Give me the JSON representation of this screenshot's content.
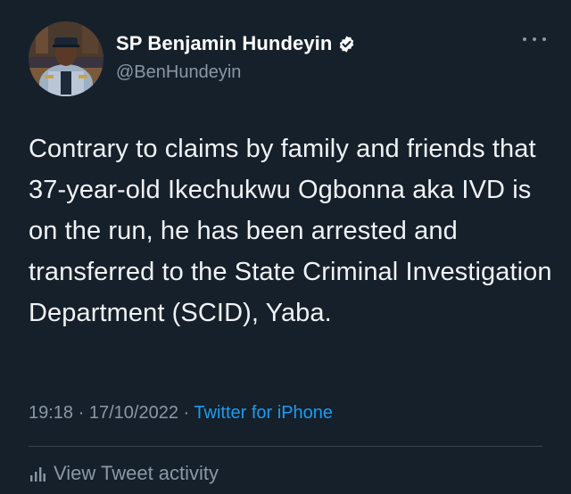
{
  "user": {
    "display_name": "SP Benjamin Hundeyin",
    "handle": "@BenHundeyin",
    "verified": true,
    "avatar_icon": "profile-photo"
  },
  "tweet": {
    "text": "Contrary to claims by family and friends that 37-year-old Ikechukwu Ogbonna aka IVD is on the run, he has been arrested and transferred to the State Criminal Investigation Department (SCID), Yaba.",
    "time": "19:18",
    "separator": "·",
    "date": "17/10/2022",
    "source": "Twitter for iPhone"
  },
  "actions": {
    "more_icon": "more-horizontal-icon",
    "activity_label": "View Tweet activity",
    "activity_icon": "bar-chart-icon"
  },
  "colors": {
    "background": "#15202b",
    "text": "#ffffff",
    "secondary": "#8b98a5",
    "link": "#1d9bf0",
    "divider": "#38444d"
  }
}
